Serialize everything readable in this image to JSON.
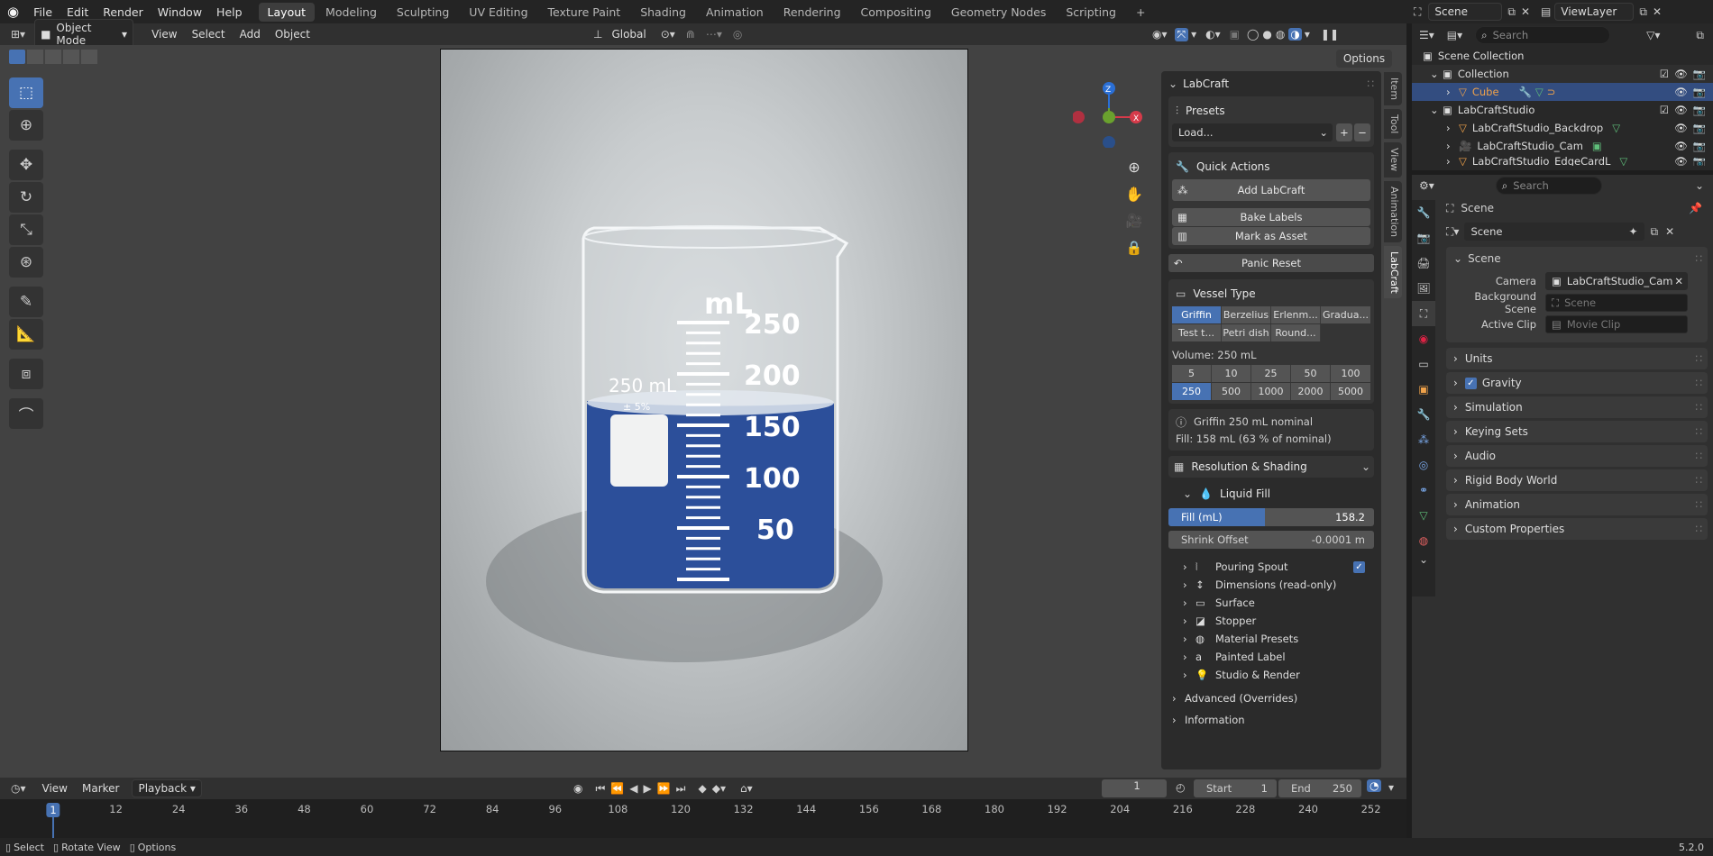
{
  "app": {
    "version": "5.2.0"
  },
  "menubar": {
    "items": [
      "File",
      "Edit",
      "Render",
      "Window",
      "Help"
    ]
  },
  "workspaces": {
    "tabs": [
      "Layout",
      "Modeling",
      "Sculpting",
      "UV Editing",
      "Texture Paint",
      "Shading",
      "Animation",
      "Rendering",
      "Compositing",
      "Geometry Nodes",
      "Scripting"
    ],
    "active": "Layout",
    "add": "+"
  },
  "scene_selector": {
    "scene": "Scene",
    "view_layer": "ViewLayer"
  },
  "viewport_header": {
    "mode": "Object Mode",
    "menus": [
      "View",
      "Select",
      "Add",
      "Object"
    ],
    "orientation": "Global",
    "options": "Options"
  },
  "beaker": {
    "unit": "mL",
    "marks": [
      "250",
      "200",
      "150",
      "100",
      "50"
    ],
    "cap_text": "250 mL",
    "tol": "± 5%"
  },
  "labcraft": {
    "title": "LabCraft",
    "presets_title": "Presets",
    "preset_value": "Load...",
    "plus": "+",
    "minus": "−",
    "quick_title": "Quick Actions",
    "add": "Add LabCraft",
    "bake": "Bake Labels",
    "asset": "Mark as Asset",
    "panic": "Panic Reset",
    "vessel_title": "Vessel Type",
    "vessels": [
      "Griffin",
      "Berzelius",
      "Erlenm...",
      "Gradua...",
      "Test t...",
      "Petri dish",
      "Round..."
    ],
    "volume_label": "Volume: 250 mL",
    "volumes": [
      "5",
      "10",
      "25",
      "50",
      "100",
      "250",
      "500",
      "1000",
      "2000",
      "5000"
    ],
    "info_name": "Griffin 250 mL nominal",
    "info_fill": "Fill: 158 mL (63 % of nominal)",
    "res_title": "Resolution & Shading",
    "liquid_title": "Liquid Fill",
    "fill_label": "Fill (mL)",
    "fill_value": "158.2",
    "fill_fraction": 0.47,
    "shrink_label": "Shrink Offset",
    "shrink_value": "-0.0001 m",
    "subpanels": [
      "Pouring Spout",
      "Dimensions (read-only)",
      "Surface",
      "Stopper",
      "Material Presets",
      "Painted Label",
      "Studio & Render"
    ],
    "advanced": "Advanced (Overrides)",
    "information": "Information"
  },
  "ntabs": [
    "Item",
    "Tool",
    "View",
    "Animation",
    "LabCraft"
  ],
  "timeline": {
    "menus": [
      "View",
      "Marker",
      "Playback"
    ],
    "frame": "1",
    "start_label": "Start",
    "start": "1",
    "end_label": "End",
    "end": "250",
    "ticks": [
      "1",
      "12",
      "24",
      "36",
      "48",
      "60",
      "72",
      "84",
      "96",
      "108",
      "120",
      "132",
      "144",
      "156",
      "168",
      "180",
      "192",
      "204",
      "216",
      "228",
      "240",
      "252"
    ]
  },
  "status": {
    "select": "Select",
    "rotate": "Rotate View",
    "options": "Options"
  },
  "outliner": {
    "search": "Search",
    "rows": [
      {
        "label": "Scene Collection",
        "indent": 0
      },
      {
        "label": "Collection",
        "indent": 1
      },
      {
        "label": "Cube",
        "indent": 2
      },
      {
        "label": "LabCraftStudio",
        "indent": 1
      },
      {
        "label": "LabCraftStudio_Backdrop",
        "indent": 2
      },
      {
        "label": "LabCraftStudio_Cam",
        "indent": 2
      },
      {
        "label": "LabCraftStudio_EdgeCardL",
        "indent": 2
      }
    ]
  },
  "properties": {
    "search": "Search",
    "context": "Scene",
    "datablock": "Scene",
    "panel": "Scene",
    "camera_label": "Camera",
    "camera_value": "LabCraftStudio_Cam",
    "bg_label": "Background Scene",
    "bg_placeholder": "Scene",
    "clip_label": "Active Clip",
    "clip_placeholder": "Movie Clip",
    "sections": [
      "Units",
      "Gravity",
      "Simulation",
      "Keying Sets",
      "Audio",
      "Rigid Body World",
      "Animation",
      "Custom Properties"
    ]
  },
  "colors": {
    "accent": "#4772b3",
    "active_text": "#f0a24a"
  }
}
